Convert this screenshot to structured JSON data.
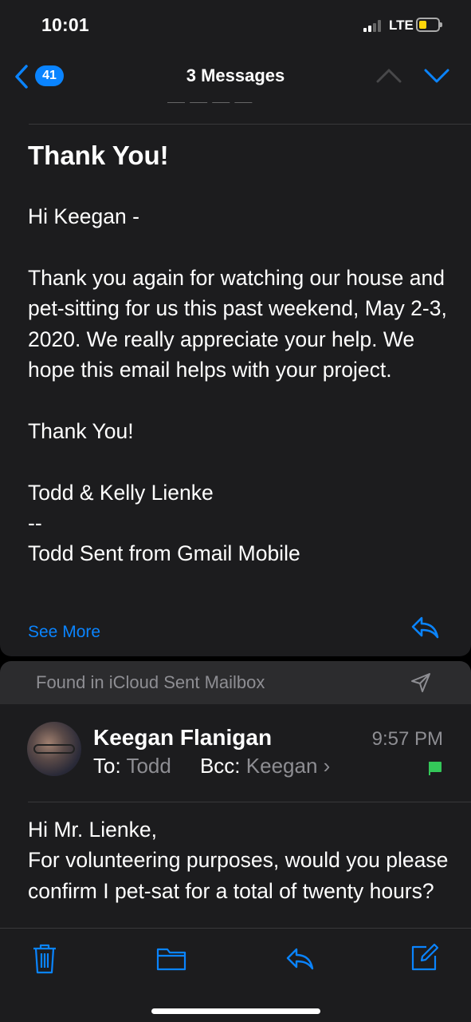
{
  "status": {
    "time": "10:01",
    "network": "LTE"
  },
  "nav": {
    "unread_count": "41",
    "title": "3 Messages"
  },
  "message1": {
    "subject": "Thank You!",
    "greeting": "Hi Keegan -",
    "paragraph": "Thank you again for watching our house and pet-sitting for us this past weekend, May 2-3, 2020. We really appreciate your help. We hope this email helps with your project.",
    "closing": "Thank You!",
    "signature": "Todd & Kelly Lienke",
    "sig_separator": "--",
    "footer": "Todd Sent from Gmail Mobile",
    "see_more": "See More"
  },
  "found_banner": {
    "text": "Found in iCloud Sent Mailbox"
  },
  "message2": {
    "sender": "Keegan Flanigan",
    "time": "9:57 PM",
    "to_label": "To:",
    "to": "Todd",
    "bcc_label": "Bcc:",
    "bcc": "Keegan",
    "chevron": "›",
    "line1": "Hi Mr. Lienke,",
    "line2": "For volunteering purposes, would you please confirm I pet-sat for a total of twenty hours?"
  },
  "colors": {
    "accent": "#0a84ff",
    "flag": "#34c759",
    "background": "#1c1c1e",
    "battery": "#ffd60a"
  },
  "icons": [
    "back-chevron-icon",
    "up-chevron-icon",
    "down-chevron-icon",
    "reply-icon",
    "send-icon",
    "flag-icon",
    "trash-icon",
    "folder-icon",
    "reply-icon",
    "compose-icon"
  ]
}
